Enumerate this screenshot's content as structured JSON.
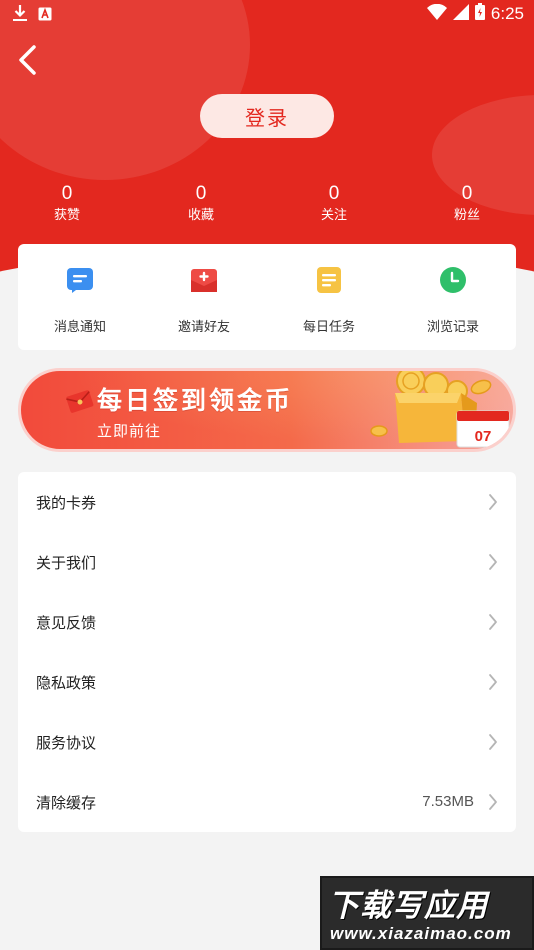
{
  "status_bar": {
    "time": "6:25",
    "icons": [
      "download-icon",
      "app-notification-icon",
      "wifi-icon",
      "signal-icon",
      "battery-icon"
    ]
  },
  "header": {
    "back_icon": "chevron-left-icon",
    "login_label": "登录",
    "stats": [
      {
        "value": "0",
        "label": "获赞"
      },
      {
        "value": "0",
        "label": "收藏"
      },
      {
        "value": "0",
        "label": "关注"
      },
      {
        "value": "0",
        "label": "粉丝"
      }
    ]
  },
  "quick_actions": [
    {
      "label": "消息通知",
      "icon": "message-icon",
      "color": "#3b8ff0"
    },
    {
      "label": "邀请好友",
      "icon": "invite-envelope-icon",
      "color": "#ee4b45"
    },
    {
      "label": "每日任务",
      "icon": "task-icon",
      "color": "#f6c343"
    },
    {
      "label": "浏览记录",
      "icon": "clock-icon",
      "color": "#2fbf6a"
    }
  ],
  "banner": {
    "title": "每日签到领金币",
    "subtitle": "立即前往",
    "calendar_day": "07"
  },
  "menu": [
    {
      "label": "我的卡券",
      "value": ""
    },
    {
      "label": "关于我们",
      "value": ""
    },
    {
      "label": "意见反馈",
      "value": ""
    },
    {
      "label": "隐私政策",
      "value": ""
    },
    {
      "label": "服务协议",
      "value": ""
    },
    {
      "label": "清除缓存",
      "value": "7.53MB"
    }
  ],
  "watermark": {
    "top": "下载写应用",
    "bottom": "www.xiazaimao.com"
  },
  "colors": {
    "primary_red": "#e3281f",
    "background": "#f3f3f3",
    "card": "#ffffff"
  }
}
